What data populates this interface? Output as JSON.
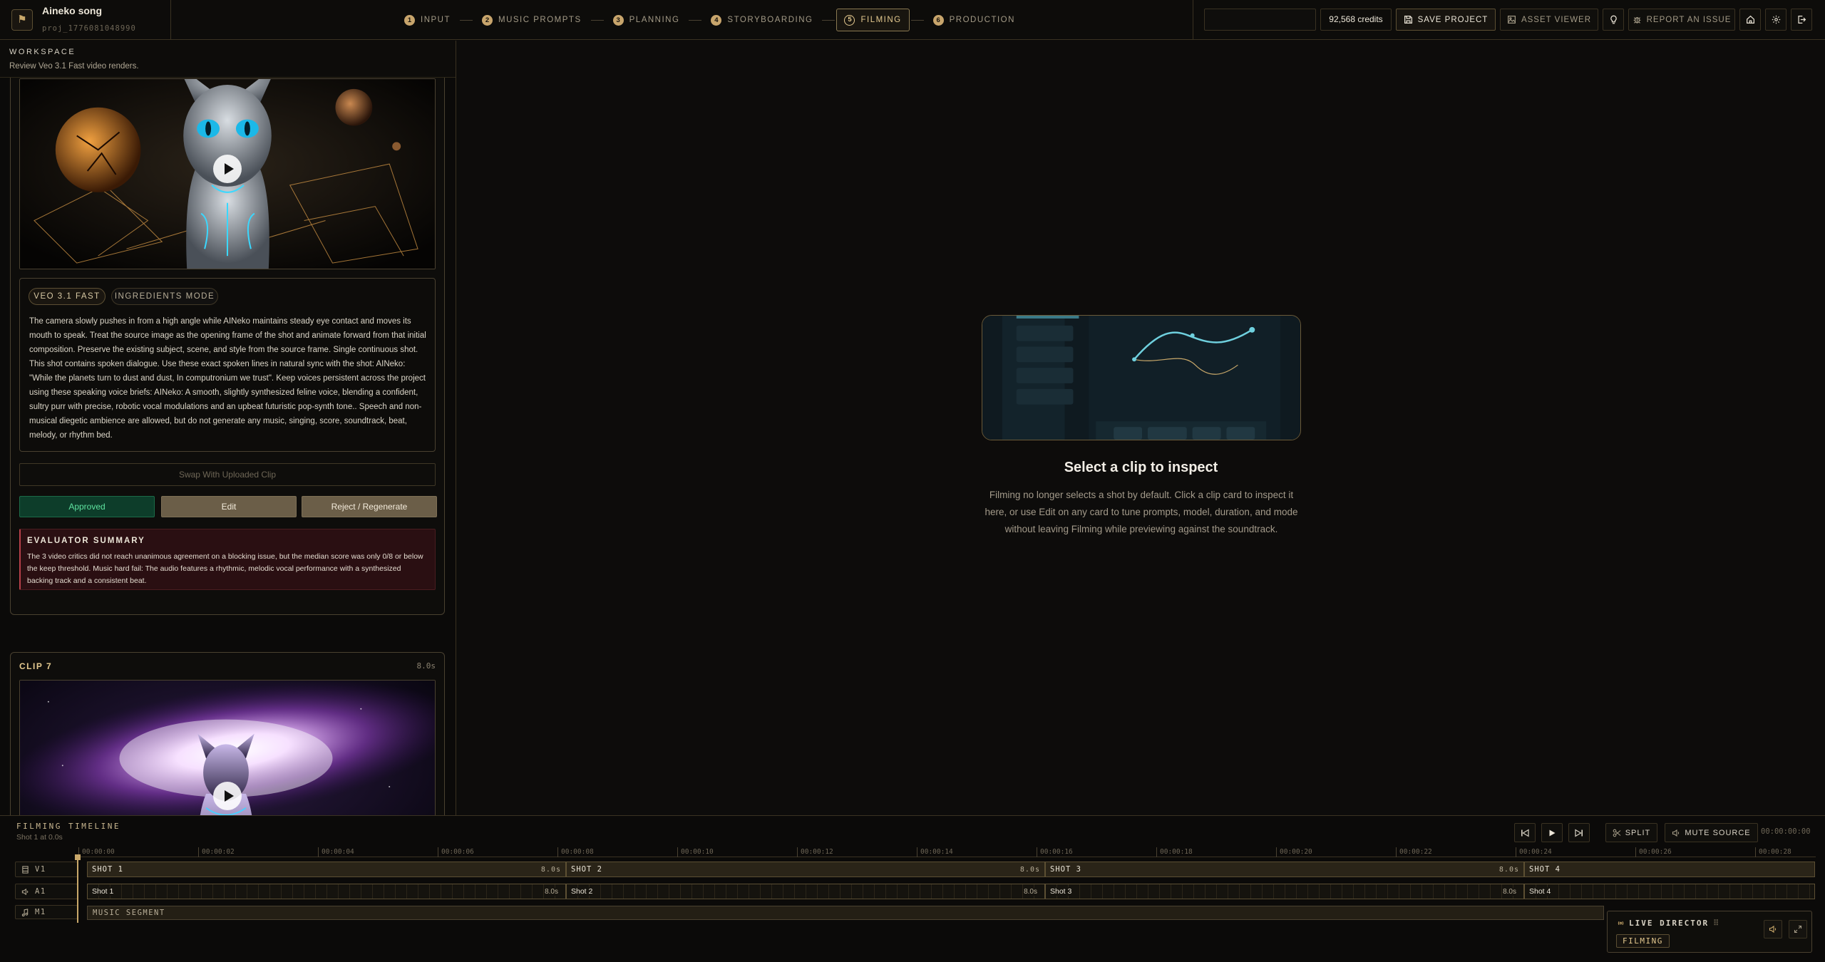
{
  "project": {
    "title": "Aineko song",
    "id": "proj_1776081048990"
  },
  "steps": [
    {
      "num": "1",
      "label": "INPUT"
    },
    {
      "num": "2",
      "label": "MUSIC PROMPTS"
    },
    {
      "num": "3",
      "label": "PLANNING"
    },
    {
      "num": "4",
      "label": "STORYBOARDING"
    },
    {
      "num": "5",
      "label": "FILMING",
      "active": true
    },
    {
      "num": "6",
      "label": "PRODUCTION"
    }
  ],
  "top": {
    "credits": "92,568 credits",
    "save_label": "SAVE PROJECT",
    "asset_label": "ASSET VIEWER",
    "report_label": "REPORT AN ISSUE"
  },
  "workspace": {
    "title": "WORKSPACE",
    "subtitle": "Review Veo 3.1 Fast video renders.",
    "clip6": {
      "model_chip": "VEO 3.1 FAST",
      "mode_chip": "INGREDIENTS MODE",
      "prompt": "The camera slowly pushes in from a high angle while AINeko maintains steady eye contact and moves its mouth to speak. Treat the source image as the opening frame of the shot and animate forward from that initial composition. Preserve the existing subject, scene, and style from the source frame. Single continuous shot. This shot contains spoken dialogue. Use these exact spoken lines in natural sync with the shot: AINeko: \"While the planets turn to dust and dust, In computronium we trust\". Keep voices persistent across the project using these speaking voice briefs: AINeko: A smooth, slightly synthesized feline voice, blending a confident, sultry purr with precise, robotic vocal modulations and an upbeat futuristic pop-synth tone.. Speech and non-musical diegetic ambience are allowed, but do not generate any music, singing, score, soundtrack, beat, melody, or rhythm bed.",
      "swap_label": "Swap With Uploaded Clip",
      "approved_label": "Approved",
      "edit_label": "Edit",
      "reject_label": "Reject / Regenerate",
      "evaluator_title": "EVALUATOR SUMMARY",
      "evaluator_text": "The 3 video critics did not reach unanimous agreement on a blocking issue, but the median score was only 0/8 or below the keep threshold. Music hard fail: The audio features a rhythmic, melodic vocal performance with a synthesized backing track and a consistent beat."
    },
    "clip7": {
      "title": "CLIP 7",
      "duration": "8.0s"
    }
  },
  "inspector": {
    "title": "Select a clip to inspect",
    "text": "Filming no longer selects a shot by default. Click a clip card to inspect it here, or use Edit on any card to tune prompts, model, duration, and mode without leaving Filming while previewing against the soundtrack."
  },
  "timeline": {
    "title": "FILMING TIMELINE",
    "subtitle": "Shot 1 at 0.0s",
    "split_label": "SPLIT",
    "mute_label": "MUTE SOURCE",
    "time": "00:00:00:00",
    "ticks": [
      "00:00:00",
      "00:00:02",
      "00:00:04",
      "00:00:06",
      "00:00:08",
      "00:00:10",
      "00:00:12",
      "00:00:14",
      "00:00:16",
      "00:00:18",
      "00:00:20",
      "00:00:22",
      "00:00:24",
      "00:00:26",
      "00:00:28"
    ],
    "tracks": {
      "v1": "V1",
      "a1": "A1",
      "m1": "M1"
    },
    "video_clips": [
      {
        "label": "SHOT 1",
        "duration": "8.0s"
      },
      {
        "label": "SHOT 2",
        "duration": "8.0s"
      },
      {
        "label": "SHOT 3",
        "duration": "8.0s"
      },
      {
        "label": "SHOT 4",
        "duration": ""
      }
    ],
    "audio_clips": [
      {
        "label": "Shot 1",
        "duration": "8.0s"
      },
      {
        "label": "Shot 2",
        "duration": "8.0s"
      },
      {
        "label": "Shot 3",
        "duration": "8.0s"
      },
      {
        "label": "Shot 4",
        "duration": ""
      }
    ],
    "music_segment": "MUSIC SEGMENT"
  },
  "live_director": {
    "title": "LIVE DIRECTOR",
    "tag": "FILMING"
  },
  "colors": {
    "accent": "#c9a86a",
    "approved": "#5fe3a0",
    "error": "#b8404a"
  }
}
